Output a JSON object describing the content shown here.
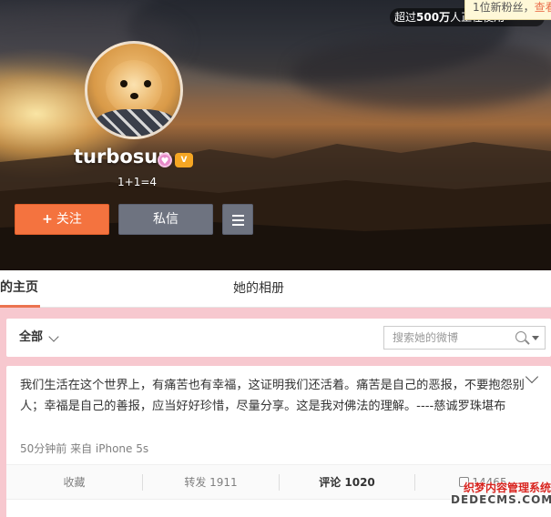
{
  "header": {
    "fans_notice": "超过500万人正在使用",
    "fans_notice_bold": "500万",
    "fans_notice_pre": "超过",
    "fans_notice_post": "人正在使用",
    "new_fans_text": "1位新粉丝，",
    "new_fans_link": "查看"
  },
  "profile": {
    "username": "turbosun",
    "level_icon": "level-badge-icon",
    "vip_icon": "vip-crown-icon",
    "bio": "1+1=4",
    "follow_label": "关注",
    "follow_plus": "+",
    "message_label": "私信",
    "more_icon": "menu-icon"
  },
  "tabs": {
    "home": "的主页",
    "album": "她的相册"
  },
  "filter": {
    "selected": "全部",
    "search_placeholder": "搜索她的微博"
  },
  "post": {
    "text": "我们生活在这个世界上，有痛苦也有幸福，这证明我们还活着。痛苦是自己的恶报，不要抱怨别人；幸福是自己的善报，应当好好珍惜，尽量分享。这是我对佛法的理解。----慈诚罗珠堪布",
    "meta": "50分钟前 来自 iPhone 5s",
    "actions": {
      "favorite": "收藏",
      "repost": "转发 1911",
      "comment": "评论 1020",
      "like": "14465"
    }
  },
  "watermark": {
    "line1": "织梦内容管理系统",
    "line2": "DEDECMS.COM"
  },
  "colors": {
    "accent": "#eb7350",
    "follow_button": "#f4733f",
    "message_button": "#6e7380",
    "background": "#f7c8cf"
  }
}
